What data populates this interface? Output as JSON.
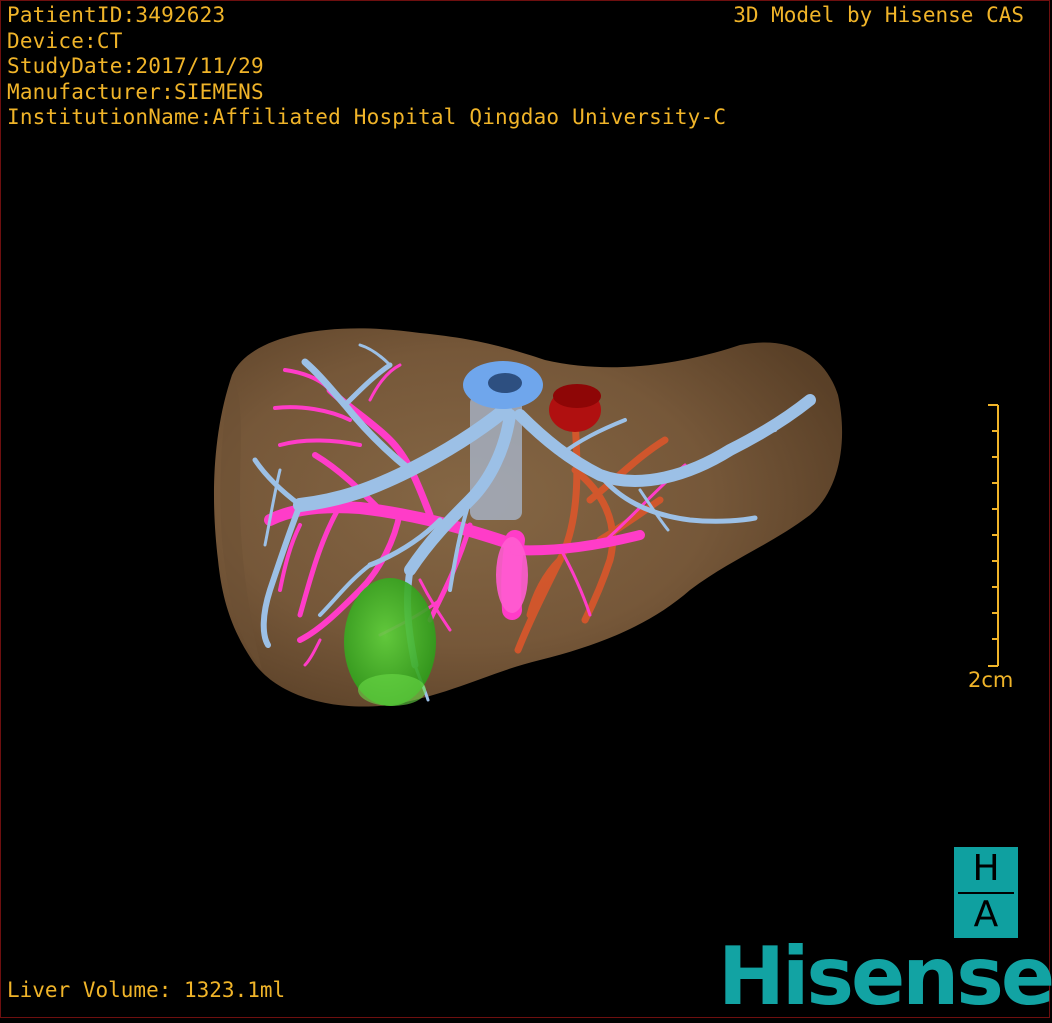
{
  "header": {
    "patient_id": "PatientID:3492623",
    "device": "Device:CT",
    "study_date": "StudyDate:2017/11/29",
    "manufacturer": "Manufacturer:SIEMENS",
    "institution": "InstitutionName:Affiliated Hospital Qingdao University-C"
  },
  "brand_caption": "3D Model by Hisense CAS",
  "scale": {
    "label": "2cm"
  },
  "logo": {
    "top_letter": "H",
    "bottom_letter": "A",
    "wordmark": "Hisense"
  },
  "footer": {
    "liver_volume": "Liver Volume: 1323.1ml"
  },
  "colors": {
    "text": "#f0b429",
    "liver": "#8a6a45",
    "hepatic_vein": "#9cc0e6",
    "portal_vein": "#ff3cc8",
    "ivc_ring": "#6fa6ec",
    "aorta": "#b01010",
    "gallbladder": "#39c021",
    "artery": "#e0562a",
    "brand": "#12a3a3"
  },
  "icons": [
    "liver-3d-model",
    "scale-bar",
    "ha-logo"
  ]
}
